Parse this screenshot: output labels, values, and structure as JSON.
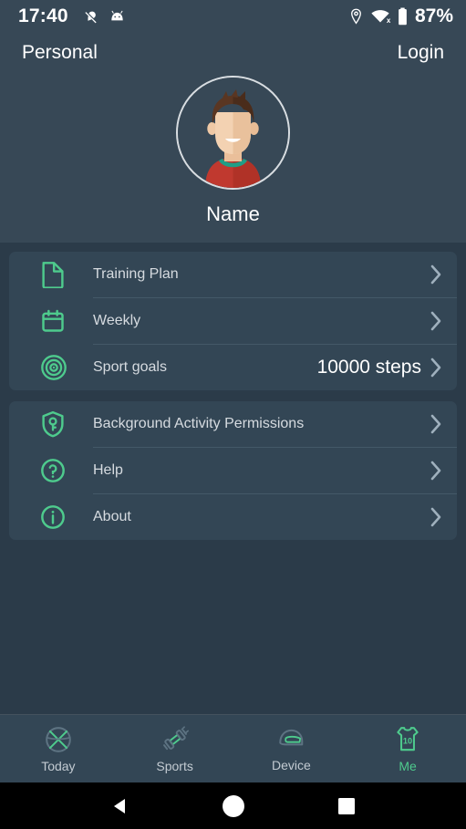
{
  "status_bar": {
    "time": "17:40",
    "battery_percent": "87%",
    "icons": [
      "location-off-icon",
      "android-head-icon",
      "location-pin-icon",
      "wifi-off-icon",
      "battery-icon"
    ]
  },
  "header": {
    "title": "Personal",
    "login_label": "Login",
    "user_name": "Name",
    "avatar_icon": "user-avatar-illustration"
  },
  "menu_groups": [
    {
      "items": [
        {
          "icon": "document-icon",
          "label": "Training Plan",
          "value": ""
        },
        {
          "icon": "calendar-icon",
          "label": "Weekly",
          "value": ""
        },
        {
          "icon": "target-icon",
          "label": "Sport goals",
          "value": "10000 steps"
        }
      ]
    },
    {
      "items": [
        {
          "icon": "shield-key-icon",
          "label": "Background Activity Permissions",
          "value": ""
        },
        {
          "icon": "question-circle-icon",
          "label": "Help",
          "value": ""
        },
        {
          "icon": "info-circle-icon",
          "label": "About",
          "value": ""
        }
      ]
    }
  ],
  "bottom_nav": [
    {
      "icon": "basketball-icon",
      "label": "Today",
      "active": false
    },
    {
      "icon": "dumbbell-icon",
      "label": "Sports",
      "active": false
    },
    {
      "icon": "helmet-icon",
      "label": "Device",
      "active": false
    },
    {
      "icon": "jersey-icon",
      "label": "Me",
      "active": true,
      "jersey_number": "10"
    }
  ],
  "android_nav": [
    {
      "icon": "back-triangle-icon"
    },
    {
      "icon": "home-circle-icon"
    },
    {
      "icon": "recents-square-icon"
    }
  ],
  "colors": {
    "accent_green": "#4ecb8d",
    "header_bg": "#374856",
    "page_bg": "#2b3b49",
    "card_bg": "#334655",
    "inactive_nav": "#5d7382"
  }
}
